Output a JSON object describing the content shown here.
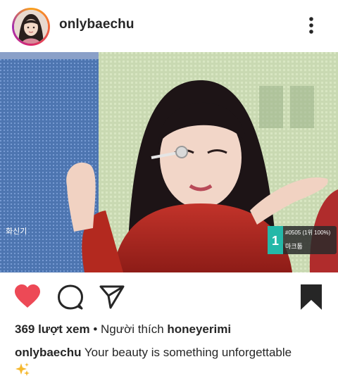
{
  "post": {
    "username": "onlybaechu",
    "icons": {
      "more": "more-vertical-icon",
      "like": "heart-filled-icon",
      "comment": "comment-bubble-icon",
      "share": "paper-plane-icon",
      "save": "bookmark-filled-icon"
    },
    "colors": {
      "like": "#ed4956",
      "text": "#262626"
    },
    "photo": {
      "overlay_badge_top": "#0505 (1위 100%)",
      "overlay_badge_bottom": "마크툽",
      "overlay_left_text": "화신기"
    },
    "stats": {
      "views": "369 lượt xem",
      "separator": " • ",
      "liked_by_prefix": "Người thích ",
      "liked_by_user": "honeyerimi"
    },
    "caption": {
      "username": "onlybaechu",
      "text": " Your beauty is something unforgettable",
      "emoji": "sparkles-icon"
    }
  }
}
